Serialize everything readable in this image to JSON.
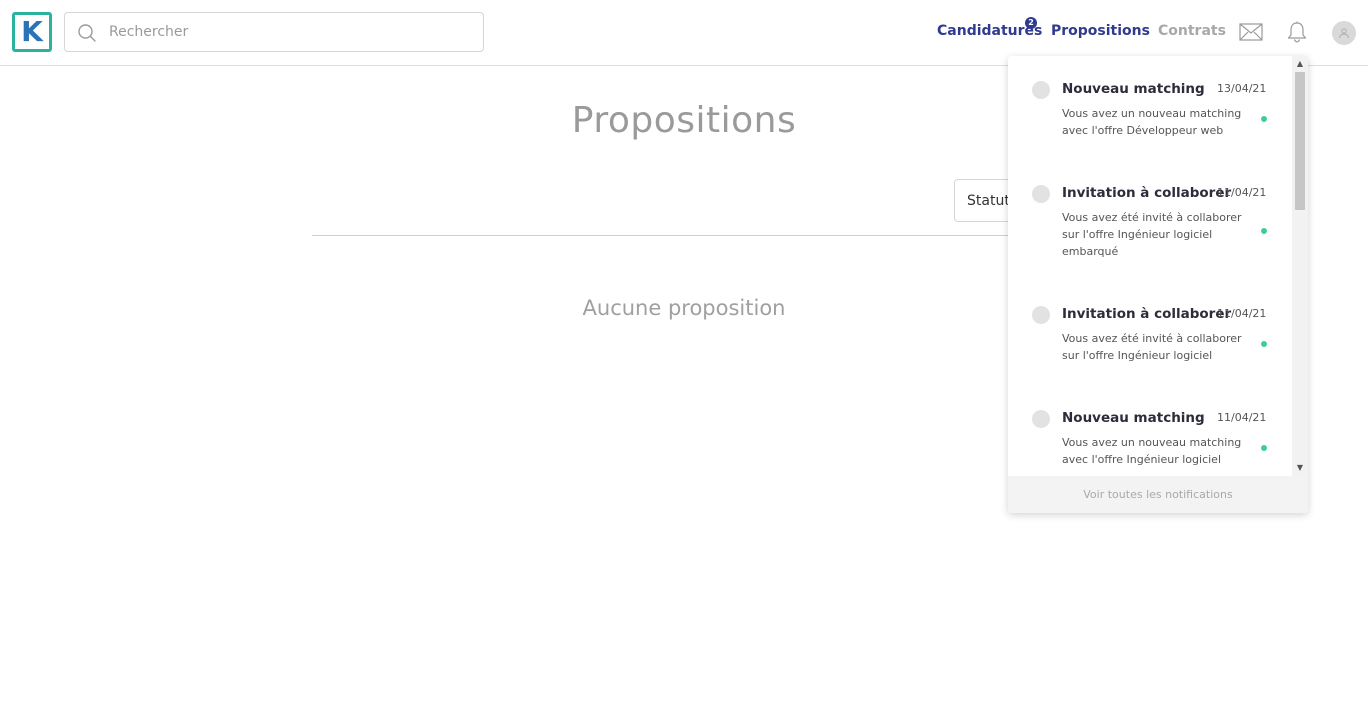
{
  "header": {
    "logo_letter": "K",
    "search": {
      "placeholder": "Rechercher",
      "value": ""
    },
    "nav": {
      "candidatures": "Candidatures",
      "candidatures_badge": "2",
      "propositions": "Propositions",
      "contrats": "Contrats"
    }
  },
  "main": {
    "title": "Propositions",
    "status_filter": "Statut",
    "empty_message": "Aucune proposition"
  },
  "notifications": {
    "items": [
      {
        "title": "Nouveau matching",
        "date": "13/04/21",
        "text": "Vous avez un nouveau matching avec l'offre Développeur web"
      },
      {
        "title": "Invitation à collaborer",
        "date": "11/04/21",
        "text": "Vous avez été invité à collaborer sur l'offre Ingénieur logiciel embarqué"
      },
      {
        "title": "Invitation à collaborer",
        "date": "11/04/21",
        "text": "Vous avez été invité à collaborer sur l'offre Ingénieur logiciel"
      },
      {
        "title": "Nouveau matching",
        "date": "11/04/21",
        "text": "Vous avez un nouveau matching avec l'offre Ingénieur logiciel"
      }
    ],
    "footer": "Voir toutes les notifications"
  },
  "colors": {
    "accent": "#2f3b8f",
    "logo_border": "#2bb3a0",
    "unread_dot": "#3ccf91"
  }
}
